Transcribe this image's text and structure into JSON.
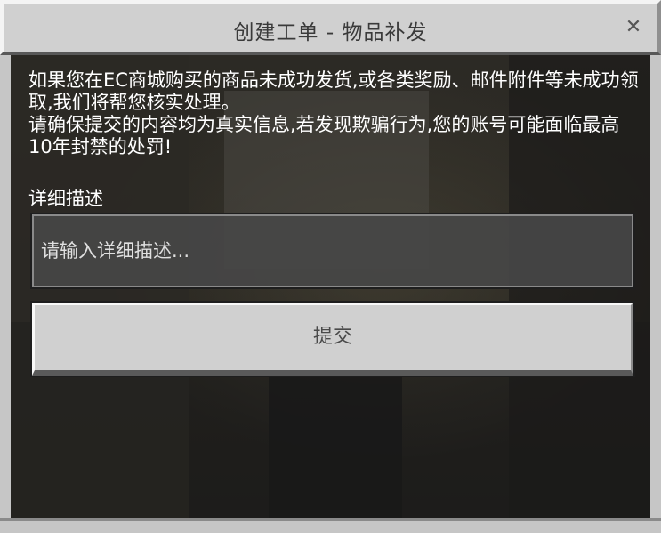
{
  "dialog": {
    "title": "创建工单 - 物品补发",
    "close_glyph": "✕",
    "description_line1": "如果您在EC商城购买的商品未成功发货,或各类奖励、邮件附件等未成功领取,我们将帮您核实处理。",
    "description_line2": "请确保提交的内容均为真实信息,若发现欺骗行为,您的账号可能面临最高10年封禁的处罚!",
    "detail_label": "详细描述",
    "detail_placeholder": "请输入详细描述...",
    "submit_label": "提交"
  },
  "icons": {
    "close": "close-icon"
  },
  "colors": {
    "frame": "#c6c6c6",
    "titlebar": "#d0d0d0",
    "button": "#d0d0d0",
    "input_bg": "#464646",
    "text": "#ffffff"
  }
}
